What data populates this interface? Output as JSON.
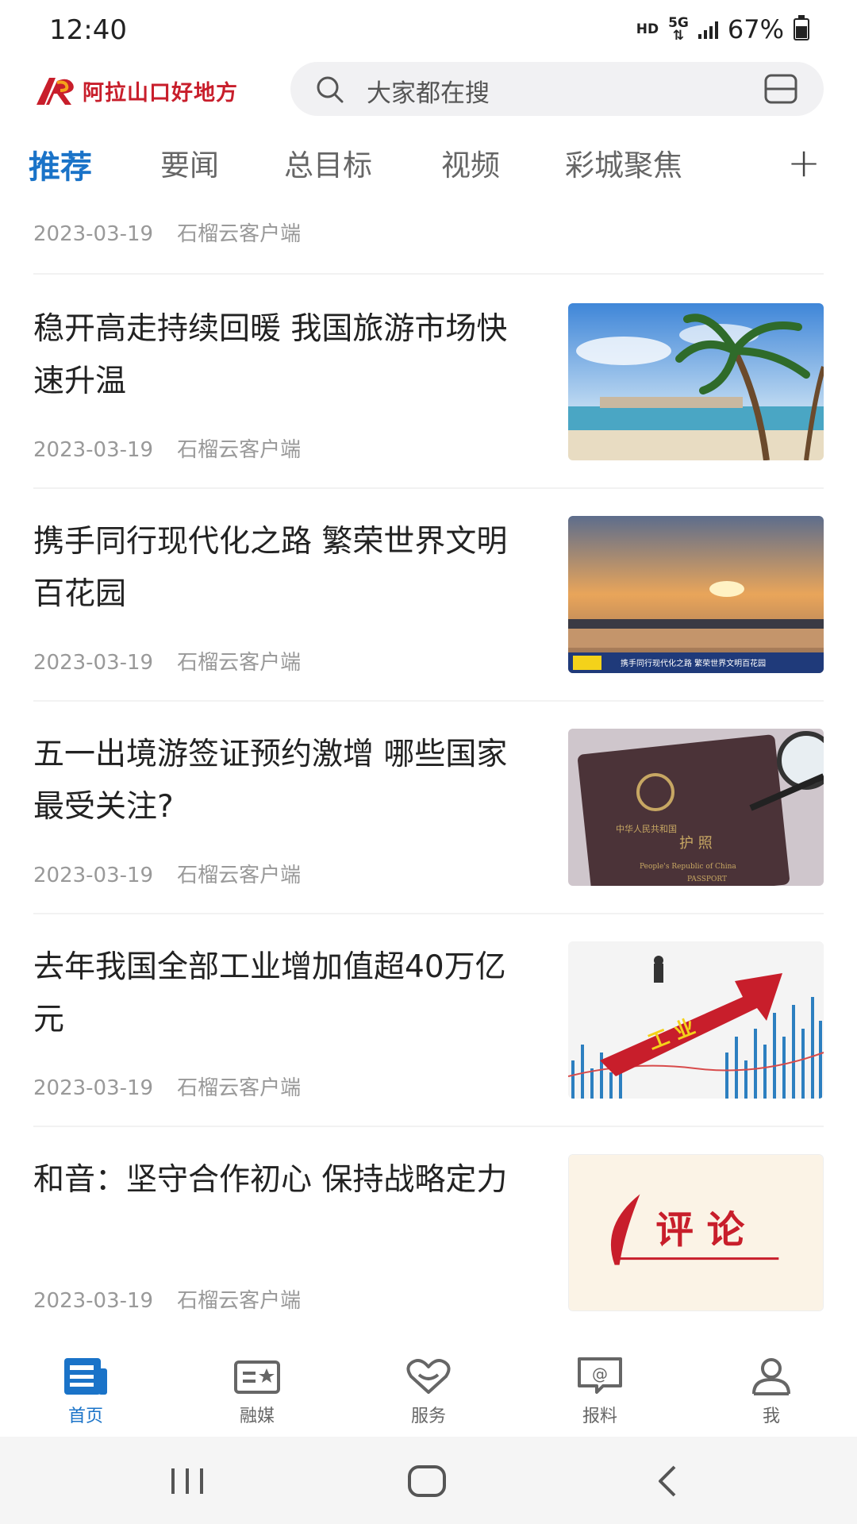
{
  "status_bar": {
    "time": "12:40",
    "hd": "HD",
    "network": "5G",
    "battery_percent": "67%"
  },
  "header": {
    "logo_text": "阿拉山口好地方",
    "search_placeholder": "大家都在搜"
  },
  "tabs": [
    {
      "label": "推荐",
      "active": true
    },
    {
      "label": "要闻",
      "active": false
    },
    {
      "label": "总目标",
      "active": false
    },
    {
      "label": "视频",
      "active": false
    },
    {
      "label": "彩城聚焦",
      "active": false
    }
  ],
  "feed": {
    "top_partial": {
      "date": "2023-03-19",
      "source": "石榴云客户端"
    },
    "articles": [
      {
        "title": "稳开高走持续回暖 我国旅游市场快速升温",
        "date": "2023-03-19",
        "source": "石榴云客户端",
        "thumb": "beach-palm"
      },
      {
        "title": "携手同行现代化之路 繁荣世界文明百花园",
        "date": "2023-03-19",
        "source": "石榴云客户端",
        "thumb": "sunset-sea",
        "thumb_caption": "携手同行现代化之路 繁荣世界文明百花园"
      },
      {
        "title": "五一出境游签证预约激增 哪些国家最受关注?",
        "date": "2023-03-19",
        "source": "石榴云客户端",
        "thumb": "passport",
        "thumb_text_1": "中华人民共和国",
        "thumb_text_2": "护 照",
        "thumb_text_3": "People's Republic of China",
        "thumb_text_4": "PASSPORT"
      },
      {
        "title": "去年我国全部工业增加值超40万亿元",
        "date": "2023-03-19",
        "source": "石榴云客户端",
        "thumb": "industry-arrow",
        "thumb_text": "工 业"
      },
      {
        "title": "和音：坚守合作初心 保持战略定力",
        "date": "2023-03-19",
        "source": "石榴云客户端",
        "thumb": "commentary",
        "thumb_text": "评 论"
      }
    ]
  },
  "bottom_nav": [
    {
      "label": "首页",
      "icon": "news-icon",
      "active": true
    },
    {
      "label": "融媒",
      "icon": "media-card-icon",
      "active": false
    },
    {
      "label": "服务",
      "icon": "heart-icon",
      "active": false
    },
    {
      "label": "报料",
      "icon": "chat-at-icon",
      "active": false
    },
    {
      "label": "我",
      "icon": "user-icon",
      "active": false
    }
  ],
  "colors": {
    "accent": "#1a73c8",
    "brand_red": "#c81e2b",
    "meta_gray": "#999999"
  }
}
